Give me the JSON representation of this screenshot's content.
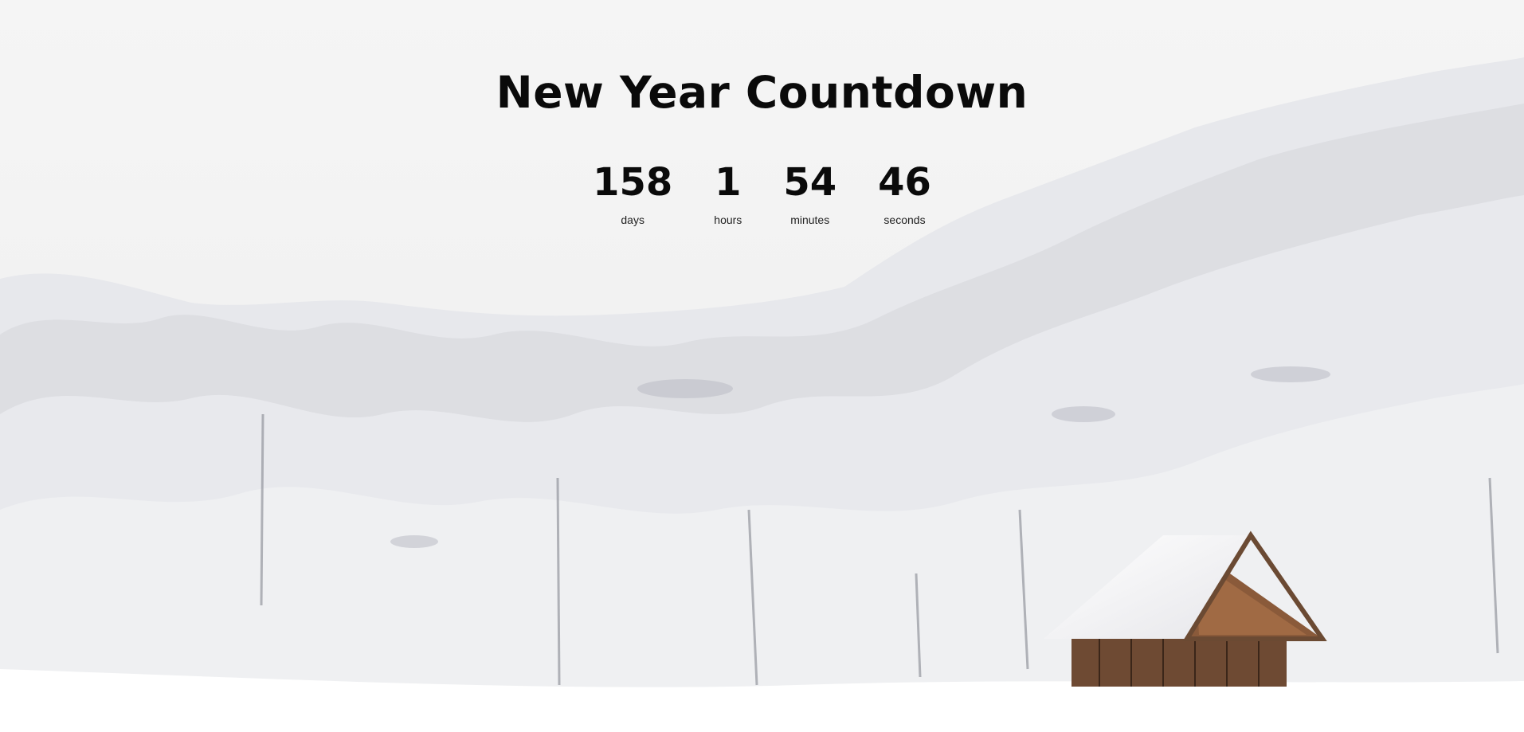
{
  "page": {
    "title": "New Year Countdown"
  },
  "countdown": [
    {
      "value": "158",
      "label": "days"
    },
    {
      "value": "1",
      "label": "hours"
    },
    {
      "value": "54",
      "label": "minutes"
    },
    {
      "value": "46",
      "label": "seconds"
    }
  ],
  "background": {
    "colors": {
      "sky": "#f4f4f4",
      "snow": "#ffffff",
      "tree_shadow": "#b9bcc4",
      "cabin_wood": "#6e4a33"
    }
  }
}
